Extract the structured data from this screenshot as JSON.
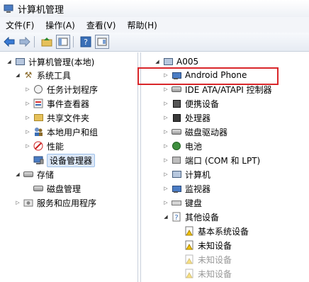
{
  "window": {
    "title": "计算机管理"
  },
  "menu": [
    {
      "label": "文件(F)"
    },
    {
      "label": "操作(A)"
    },
    {
      "label": "查看(V)"
    },
    {
      "label": "帮助(H)"
    }
  ],
  "toolbar": {
    "icons": [
      "back-arrow-icon",
      "forward-arrow-icon",
      "up-folder-icon",
      "show-hide-tree-icon",
      "help-icon",
      "properties-icon"
    ]
  },
  "left_tree": [
    {
      "label": "计算机管理(本地)",
      "icon": "computer-management-icon",
      "indent": 0,
      "arrow": "open"
    },
    {
      "label": "系统工具",
      "icon": "system-tools-icon",
      "indent": 1,
      "arrow": "open"
    },
    {
      "label": "任务计划程序",
      "icon": "clock-icon",
      "indent": 2,
      "arrow": "closed"
    },
    {
      "label": "事件查看器",
      "icon": "event-viewer-icon",
      "indent": 2,
      "arrow": "closed"
    },
    {
      "label": "共享文件夹",
      "icon": "shared-folder-icon",
      "indent": 2,
      "arrow": "closed"
    },
    {
      "label": "本地用户和组",
      "icon": "users-icon",
      "indent": 2,
      "arrow": "closed"
    },
    {
      "label": "性能",
      "icon": "performance-icon",
      "indent": 2,
      "arrow": "closed"
    },
    {
      "label": "设备管理器",
      "icon": "device-manager-icon",
      "indent": 2,
      "arrow": "none",
      "selected": true
    },
    {
      "label": "存储",
      "icon": "storage-icon",
      "indent": 1,
      "arrow": "open"
    },
    {
      "label": "磁盘管理",
      "icon": "disk-management-icon",
      "indent": 2,
      "arrow": "none"
    },
    {
      "label": "服务和应用程序",
      "icon": "services-icon",
      "indent": 1,
      "arrow": "closed"
    }
  ],
  "right_tree": [
    {
      "label": "A005",
      "icon": "computer-icon",
      "indent": 0,
      "arrow": "open"
    },
    {
      "label": "Android Phone",
      "icon": "monitor-icon",
      "indent": 1,
      "arrow": "closed",
      "highlighted": true
    },
    {
      "label": "IDE ATA/ATAPI 控制器",
      "icon": "ide-controller-icon",
      "indent": 1,
      "arrow": "closed"
    },
    {
      "label": "便携设备",
      "icon": "portable-device-icon",
      "indent": 1,
      "arrow": "closed"
    },
    {
      "label": "处理器",
      "icon": "processor-icon",
      "indent": 1,
      "arrow": "closed"
    },
    {
      "label": "磁盘驱动器",
      "icon": "disk-drive-icon",
      "indent": 1,
      "arrow": "closed"
    },
    {
      "label": "电池",
      "icon": "battery-icon",
      "indent": 1,
      "arrow": "closed"
    },
    {
      "label": "端口 (COM 和 LPT)",
      "icon": "port-icon",
      "indent": 1,
      "arrow": "closed"
    },
    {
      "label": "计算机",
      "icon": "computer-icon",
      "indent": 1,
      "arrow": "closed"
    },
    {
      "label": "监视器",
      "icon": "monitor-icon",
      "indent": 1,
      "arrow": "closed"
    },
    {
      "label": "键盘",
      "icon": "keyboard-icon",
      "indent": 1,
      "arrow": "closed"
    },
    {
      "label": "其他设备",
      "icon": "other-devices-icon",
      "indent": 1,
      "arrow": "open"
    },
    {
      "label": "基本系统设备",
      "icon": "warning-device-icon",
      "indent": 2,
      "arrow": "none"
    },
    {
      "label": "未知设备",
      "icon": "warning-device-icon",
      "indent": 2,
      "arrow": "none"
    },
    {
      "label": "未知设备",
      "icon": "warning-device-icon",
      "indent": 2,
      "arrow": "none",
      "disabled": true
    },
    {
      "label": "未知设备",
      "icon": "warning-device-icon",
      "indent": 2,
      "arrow": "none",
      "disabled": true
    }
  ],
  "colors": {
    "highlight_box": "#d9262a",
    "selection_bg": "#dbe7f7",
    "title_bg": "#eef1f6"
  }
}
